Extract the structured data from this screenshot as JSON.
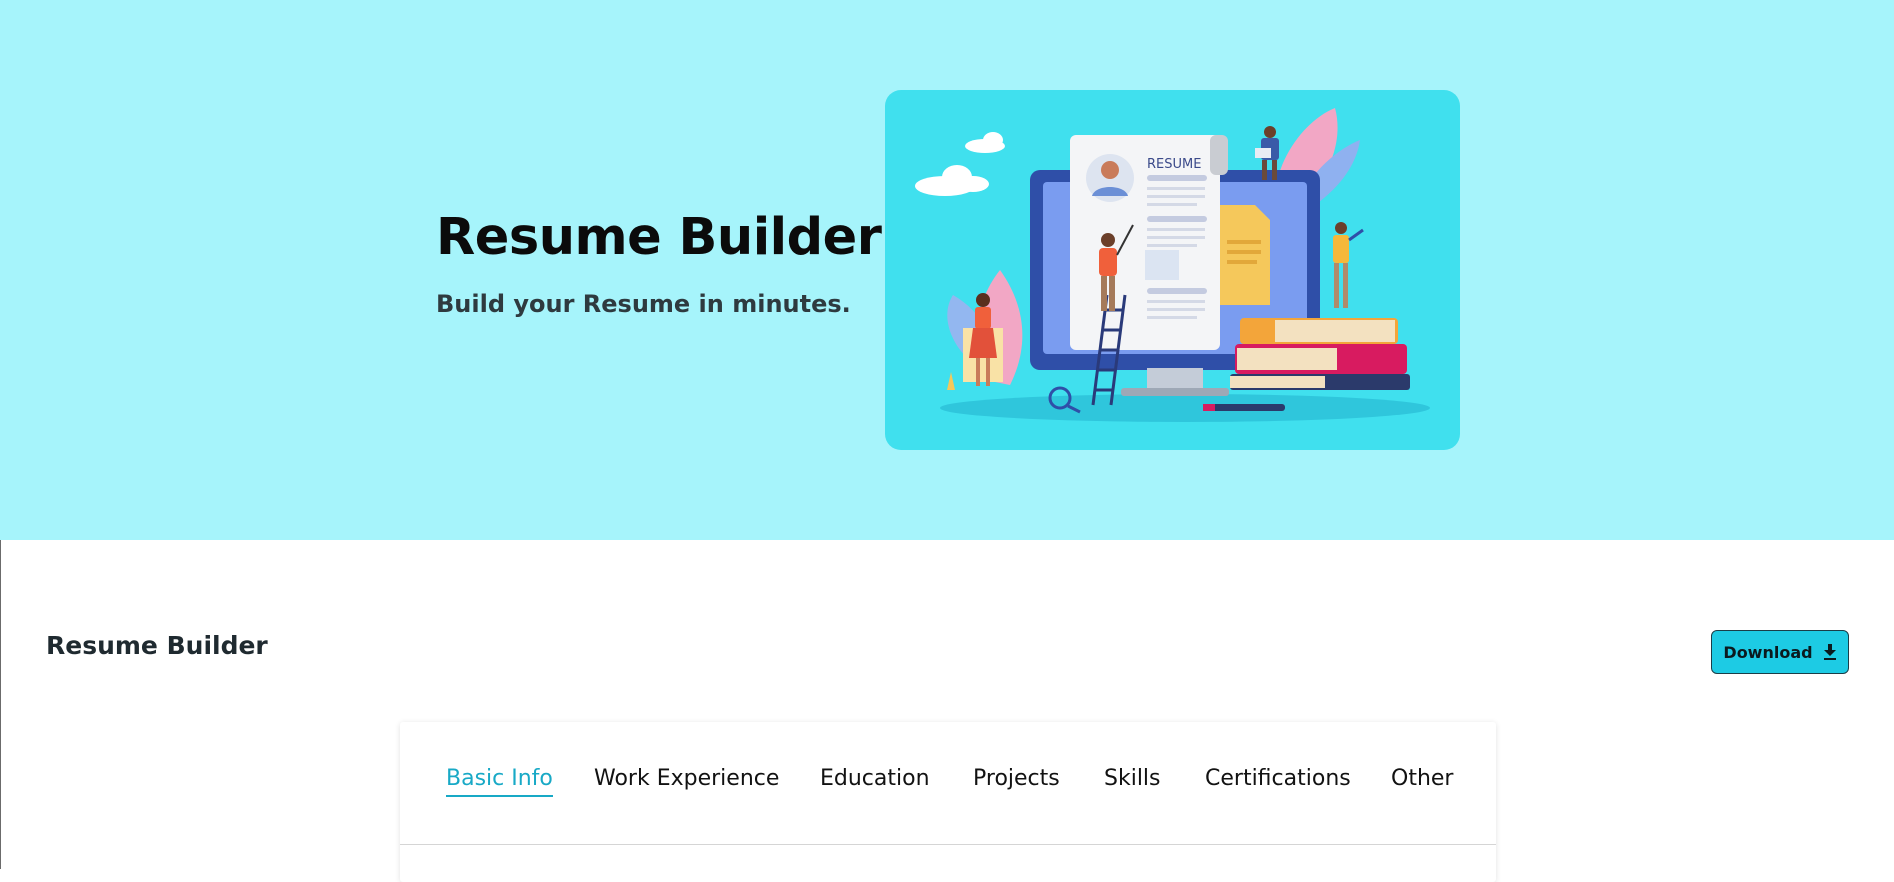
{
  "hero": {
    "title": "Resume Builder",
    "subtitle": "Build your Resume in minutes.",
    "illustration": {
      "document_label": "RESUME",
      "background_color": "#40e0ee"
    },
    "background_color": "#a6f4fb"
  },
  "toolbar": {
    "title": "Resume Builder",
    "download_label": "Download",
    "download_icon": "download-icon",
    "accent_color": "#1dcbe4"
  },
  "tabs": {
    "active_color": "#18a9c6",
    "items": [
      {
        "label": "Basic Info",
        "active": true
      },
      {
        "label": "Work Experience",
        "active": false
      },
      {
        "label": "Education",
        "active": false
      },
      {
        "label": "Projects",
        "active": false
      },
      {
        "label": "Skills",
        "active": false
      },
      {
        "label": "Certifications",
        "active": false
      },
      {
        "label": "Other",
        "active": false
      }
    ]
  }
}
